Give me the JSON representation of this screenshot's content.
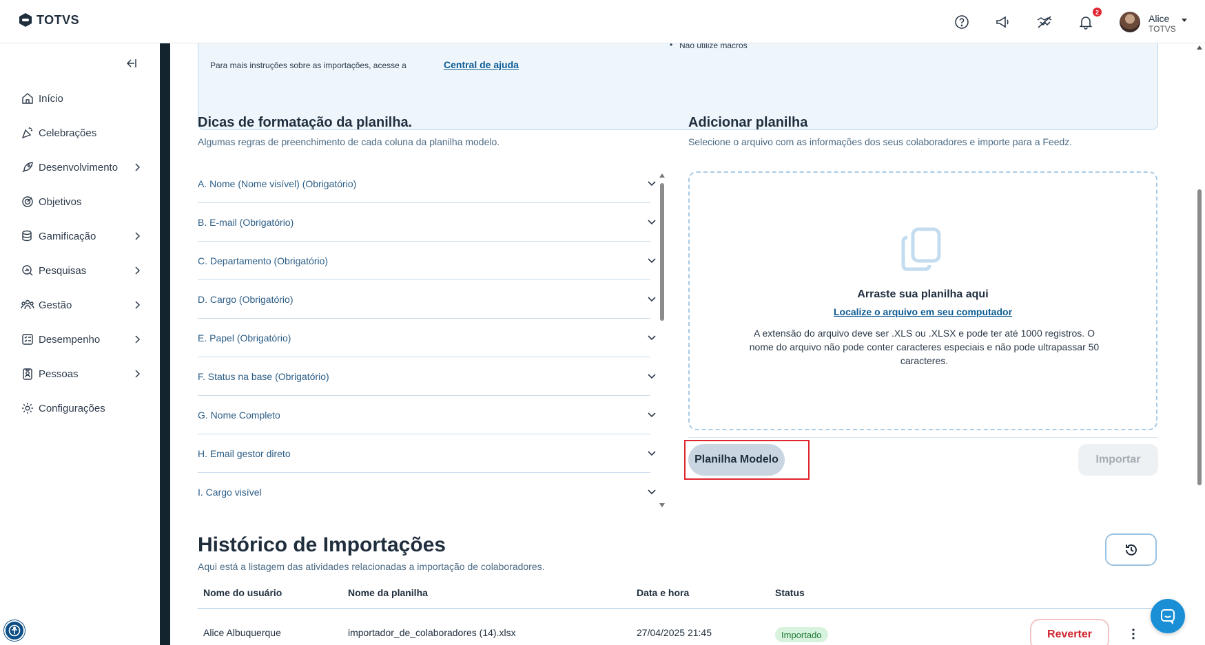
{
  "topbar": {
    "logo_text": "TOTVS",
    "icons": [
      "help-icon",
      "megaphone-icon",
      "handshake-icon",
      "bell-icon"
    ],
    "notification_count": "2",
    "user_name": "Alice",
    "user_company": "TOTVS"
  },
  "sidebar": {
    "items": [
      {
        "label": "Início",
        "icon": "home-icon",
        "has_children": false
      },
      {
        "label": "Celebrações",
        "icon": "party-icon",
        "has_children": false
      },
      {
        "label": "Desenvolvimento",
        "icon": "rocket-icon",
        "has_children": true
      },
      {
        "label": "Objetivos",
        "icon": "target-icon",
        "has_children": false
      },
      {
        "label": "Gamificação",
        "icon": "coins-icon",
        "has_children": true
      },
      {
        "label": "Pesquisas",
        "icon": "survey-icon",
        "has_children": true
      },
      {
        "label": "Gestão",
        "icon": "people-icon",
        "has_children": true
      },
      {
        "label": "Desempenho",
        "icon": "checklist-icon",
        "has_children": true
      },
      {
        "label": "Pessoas",
        "icon": "badge-icon",
        "has_children": true
      },
      {
        "label": "Configurações",
        "icon": "gear-icon",
        "has_children": false
      }
    ]
  },
  "info": {
    "bullet": "Não utilize macros",
    "text": "Para mais instruções sobre as importações, acesse a",
    "link": "Central de ajuda"
  },
  "tips": {
    "title": "Dicas de formatação da planilha.",
    "subtitle": "Algumas regras de preenchimento de cada coluna da planilha modelo.",
    "items": [
      "A. Nome (Nome visível) (Obrigatório)",
      "B. E-mail (Obrigatório)",
      "C. Departamento (Obrigatório)",
      "D. Cargo (Obrigatório)",
      "E. Papel (Obrigatório)",
      "F. Status na base (Obrigatório)",
      "G. Nome Completo",
      "H. Email gestor direto",
      "I. Cargo visível"
    ]
  },
  "upload": {
    "title": "Adicionar planilha",
    "subtitle": "Selecione o arquivo com as informações dos seus colaboradores e importe para a Feedz.",
    "drop_title": "Arraste sua planilha aqui",
    "drop_link": "Localize o arquivo em seu computador",
    "drop_desc": "A extensão do arquivo deve ser .XLS ou .XLSX e pode ter até 1000 registros. O nome do arquivo não pode conter caracteres especiais e não pode ultrapassar 50 caracteres.",
    "model_button": "Planilha Modelo",
    "import_button": "Importar"
  },
  "history": {
    "title": "Histórico de Importações",
    "subtitle": "Aqui está a listagem das atividades relacionadas a importação de colaboradores.",
    "columns": [
      "Nome do usuário",
      "Nome da planilha",
      "Data e hora",
      "Status"
    ],
    "rows": [
      {
        "user": "Alice Albuquerque",
        "file": "importador_de_colaboradores (14).xlsx",
        "datetime": "27/04/2025 21:45",
        "status": "Importado",
        "action": "Reverter"
      }
    ]
  },
  "colors": {
    "accent_link": "#0d5b94",
    "sidebar_frame": "#13242f",
    "highlight": "#e0252f",
    "status_success": "#1e7a34"
  }
}
